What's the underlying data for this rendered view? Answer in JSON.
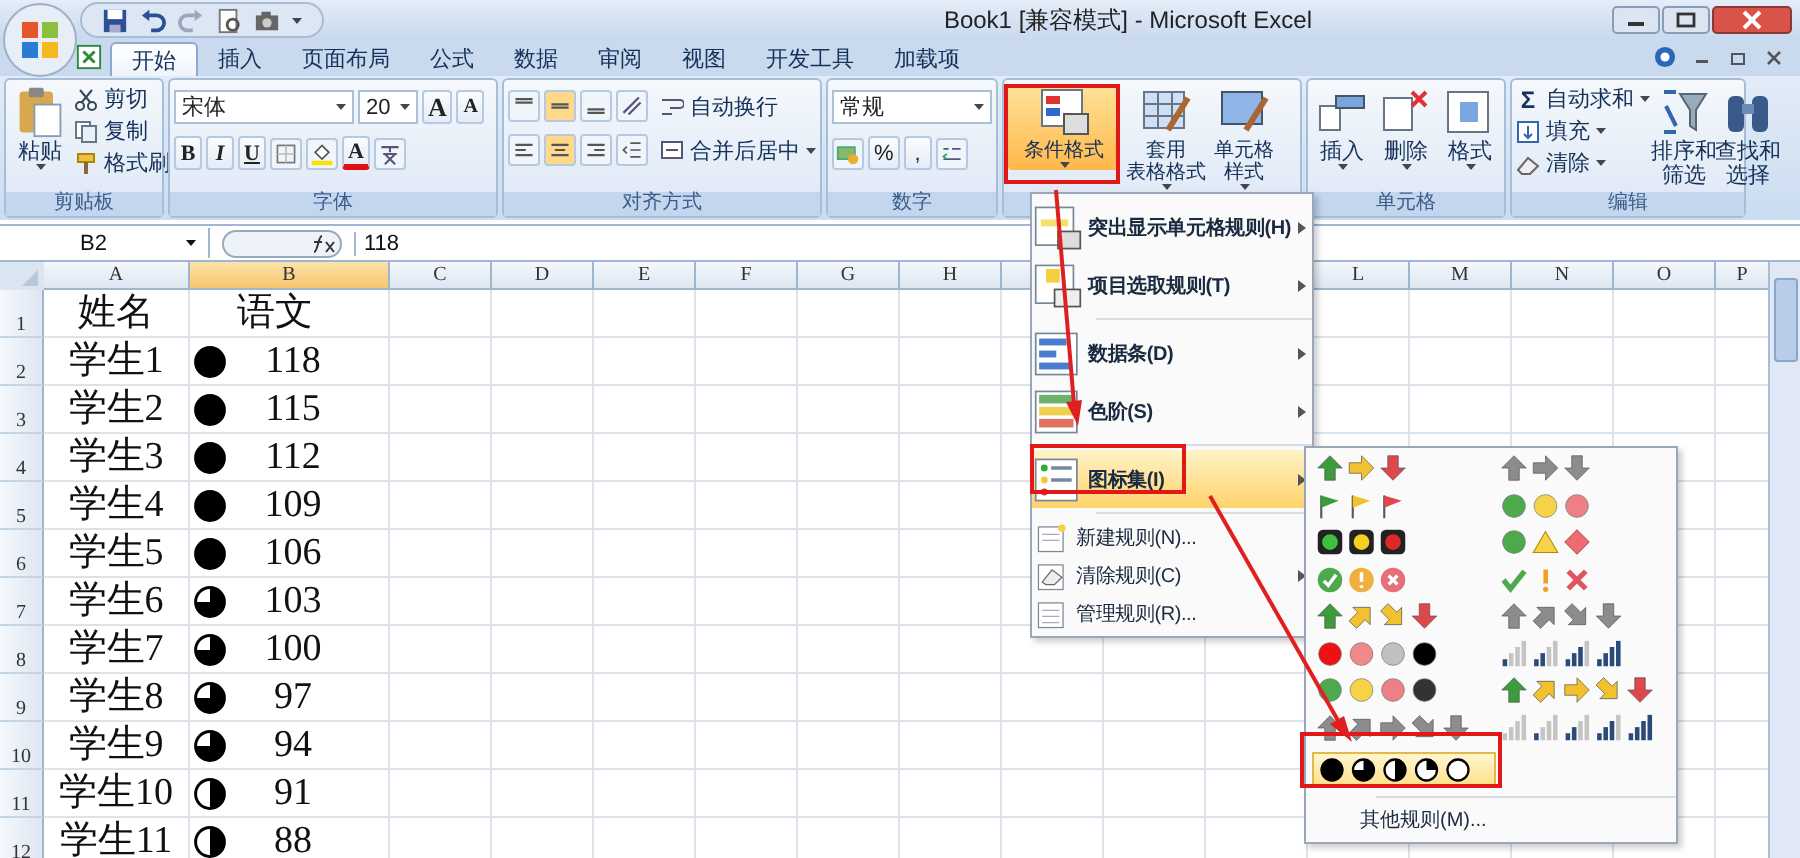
{
  "window": {
    "title": "Book1  [兼容模式] - Microsoft Excel"
  },
  "tabs": [
    {
      "label": "开始",
      "selected": true
    },
    {
      "label": "插入",
      "selected": false
    },
    {
      "label": "页面布局",
      "selected": false
    },
    {
      "label": "公式",
      "selected": false
    },
    {
      "label": "数据",
      "selected": false
    },
    {
      "label": "审阅",
      "selected": false
    },
    {
      "label": "视图",
      "selected": false
    },
    {
      "label": "开发工具",
      "selected": false
    },
    {
      "label": "加载项",
      "selected": false
    }
  ],
  "ribbon": {
    "clipboard": {
      "label": "剪贴板",
      "paste": "粘贴",
      "items": [
        "剪切",
        "复制",
        "格式刷"
      ]
    },
    "font": {
      "label": "字体",
      "name": "宋体",
      "size": "20",
      "size_buttons": [
        "A",
        "A"
      ],
      "style_buttons": [
        "B",
        "I",
        "U"
      ],
      "color_button": "A"
    },
    "alignment": {
      "label": "对齐方式",
      "wrap": "自动换行",
      "merge": "合并后居中"
    },
    "number": {
      "label": "数字",
      "format": "常规",
      "buttons": [
        "%",
        ","
      ]
    },
    "styles": {
      "buttons": [
        {
          "kind": "conditional",
          "lines": [
            "条件格式"
          ],
          "selected": true
        },
        {
          "kind": "table",
          "lines": [
            "套用",
            "表格格式"
          ],
          "selected": false
        },
        {
          "kind": "cellstyle",
          "lines": [
            "单元格",
            "样式"
          ],
          "selected": false
        }
      ]
    },
    "cells": {
      "label": "单元格",
      "buttons": [
        {
          "kind": "insert",
          "label": "插入"
        },
        {
          "kind": "delete",
          "label": "删除"
        },
        {
          "kind": "format",
          "label": "格式"
        }
      ]
    },
    "editing": {
      "label": "编辑",
      "sum_symbol": "Σ",
      "items": [
        {
          "kind": "sum",
          "label": "自动求和"
        },
        {
          "kind": "fill",
          "label": "填充"
        },
        {
          "kind": "clear",
          "label": "清除"
        }
      ],
      "buttons": [
        {
          "kind": "sort",
          "lines": [
            "排序和",
            "筛选"
          ]
        },
        {
          "kind": "find",
          "lines": [
            "查找和",
            "选择"
          ]
        }
      ]
    }
  },
  "formula_bar": {
    "name_box": "B2",
    "value": "118"
  },
  "sheet": {
    "columns": [
      "A",
      "B",
      "C",
      "D",
      "E",
      "F",
      "G",
      "H",
      "L",
      "M",
      "N",
      "O",
      "P"
    ],
    "rows": [
      {
        "number": "1",
        "name": "姓名",
        "score": "语文"
      },
      {
        "number": "2",
        "name": "学生1",
        "kind": "full",
        "score": "118"
      },
      {
        "number": "3",
        "name": "学生2",
        "kind": "full",
        "score": "115"
      },
      {
        "number": "4",
        "name": "学生3",
        "kind": "full",
        "score": "112"
      },
      {
        "number": "5",
        "name": "学生4",
        "kind": "full",
        "score": "109"
      },
      {
        "number": "6",
        "name": "学生5",
        "kind": "full",
        "score": "106"
      },
      {
        "number": "7",
        "name": "学生6",
        "kind": "three-quarters",
        "score": "103"
      },
      {
        "number": "8",
        "name": "学生7",
        "kind": "three-quarters",
        "score": "100"
      },
      {
        "number": "9",
        "name": "学生8",
        "kind": "three-quarters",
        "score": "97"
      },
      {
        "number": "10",
        "name": "学生9",
        "kind": "three-quarters",
        "score": "94"
      },
      {
        "number": "11",
        "name": "学生10",
        "kind": "half",
        "score": "91"
      },
      {
        "number": "12",
        "name": "学生11",
        "kind": "half",
        "score": "88"
      }
    ]
  },
  "menu": {
    "items": [
      {
        "kind": "highlight",
        "label": "突出显示单元格规则(H)",
        "submenu": true,
        "selected": false
      },
      {
        "kind": "topbottom",
        "label": "项目选取规则(T)",
        "submenu": true,
        "selected": false
      },
      {
        "kind": "databars",
        "label": "数据条(D)",
        "submenu": true,
        "selected": false
      },
      {
        "kind": "colorscales",
        "label": "色阶(S)",
        "submenu": true,
        "selected": false
      },
      {
        "kind": "iconsets",
        "label": "图标集(I)",
        "submenu": true,
        "selected": true
      },
      {
        "kind": "newrule",
        "label": "新建规则(N)...",
        "submenu": false,
        "selected": false
      },
      {
        "kind": "clearrules",
        "label": "清除规则(C)",
        "submenu": true,
        "selected": false
      },
      {
        "kind": "managerules",
        "label": "管理规则(R)...",
        "submenu": false,
        "selected": false
      }
    ]
  },
  "icon_sets": {
    "sets": [
      {
        "kind": "arrows-3-color",
        "selected": false
      },
      {
        "kind": "arrows-3-gray",
        "selected": false
      },
      {
        "kind": "flags-3",
        "selected": false
      },
      {
        "kind": "traffic-lights-3",
        "selected": false
      },
      {
        "kind": "traffic-lights-rimmed-3",
        "selected": false
      },
      {
        "kind": "signs-3",
        "selected": false
      },
      {
        "kind": "symbols-circled-3",
        "selected": false
      },
      {
        "kind": "symbols-3",
        "selected": false
      },
      {
        "kind": "arrows-4-color",
        "selected": false
      },
      {
        "kind": "arrows-4-gray",
        "selected": false
      },
      {
        "kind": "red-to-black-4",
        "selected": false
      },
      {
        "kind": "signal-4",
        "selected": false
      },
      {
        "kind": "traffic-lights-4",
        "selected": false
      },
      {
        "kind": "arrows-5-color",
        "selected": false
      },
      {
        "kind": "arrows-5-gray",
        "selected": false
      },
      {
        "kind": "signal-5",
        "selected": false
      },
      {
        "kind": "quarters-5",
        "selected": true
      }
    ],
    "more": "其他规则(M)..."
  }
}
